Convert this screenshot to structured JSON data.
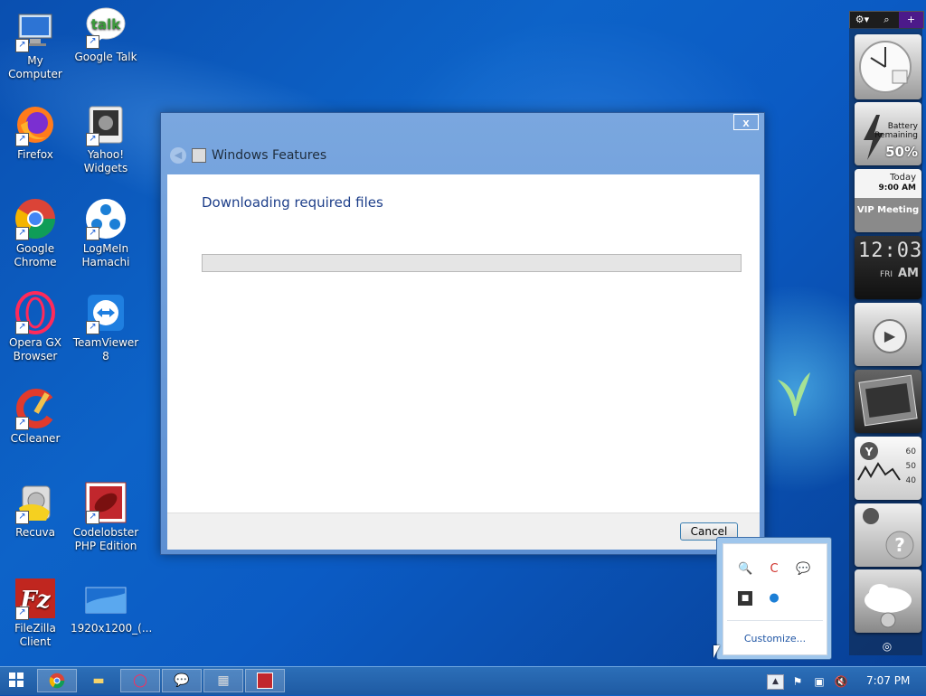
{
  "desktop": {
    "icons": [
      {
        "label": "My Computer",
        "icon": "computer-icon"
      },
      {
        "label": "Google Talk",
        "icon": "google-talk-icon",
        "badge": "talk"
      },
      {
        "label": "Firefox",
        "icon": "firefox-icon"
      },
      {
        "label": "Yahoo! Widgets",
        "icon": "yahoo-widgets-icon"
      },
      {
        "label": "Google Chrome",
        "icon": "chrome-icon"
      },
      {
        "label": "LogMeIn Hamachi",
        "icon": "hamachi-icon"
      },
      {
        "label": "Opera GX Browser",
        "icon": "opera-gx-icon"
      },
      {
        "label": "TeamViewer 8",
        "icon": "teamviewer-icon"
      },
      {
        "label": "CCleaner",
        "icon": "ccleaner-icon"
      },
      {
        "label": "Recuva",
        "icon": "recuva-icon"
      },
      {
        "label": "Codelobster PHP Edition",
        "icon": "codelobster-icon"
      },
      {
        "label": "FileZilla Client",
        "icon": "filezilla-icon"
      },
      {
        "label": "1920x1200_(...",
        "icon": "image-file-icon"
      }
    ]
  },
  "dialog": {
    "title": "Windows Features",
    "heading": "Downloading required files",
    "progress": 0,
    "cancel_label": "Cancel",
    "close_label": "x"
  },
  "tray_popup": {
    "customize_label": "Customize..."
  },
  "gadgets": {
    "battery_label": "Battery Remaining",
    "battery_value": "50%",
    "calendar_day": "Today",
    "calendar_time": "9:00 AM",
    "calendar_event": "VIP Meeting",
    "clock_time": "12:03",
    "clock_day": "FRI",
    "clock_ampm": "AM",
    "chart_ticks": [
      "60",
      "50",
      "40"
    ]
  },
  "taskbar": {
    "time": "7:07 PM"
  },
  "colors": {
    "accent": "#1e3f8a",
    "taskbar": "#1e5aa3"
  }
}
